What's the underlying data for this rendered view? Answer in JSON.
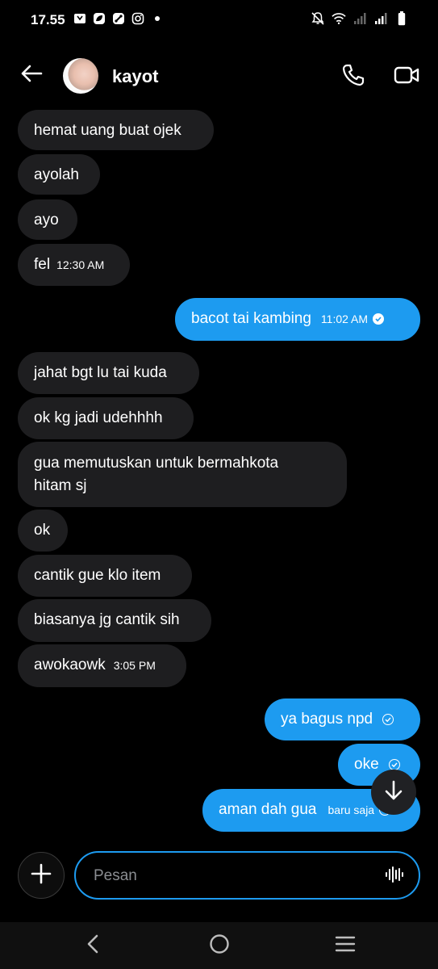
{
  "status": {
    "time": "17.55",
    "left_icons": [
      "clip-icon",
      "leaf-icon",
      "link-icon",
      "instagram-icon",
      "dot-icon"
    ],
    "right_icons": [
      "mute-icon",
      "wifi-icon",
      "signal-icon",
      "signal-icon",
      "battery-icon"
    ]
  },
  "header": {
    "contact_name": "kayot",
    "icons": [
      "back-arrow-icon",
      "phone-icon",
      "video-camera-icon"
    ]
  },
  "messages": [
    {
      "dir": "in",
      "text": "hemat uang buat ojek",
      "time": ""
    },
    {
      "dir": "in",
      "text": "ayolah",
      "time": ""
    },
    {
      "dir": "in",
      "text": "ayo",
      "time": ""
    },
    {
      "dir": "in",
      "text": "fel",
      "time": "12:30 AM"
    },
    {
      "dir": "out",
      "text": "bacot tai kambing",
      "time": "11:02 AM",
      "status": "read"
    },
    {
      "dir": "in",
      "text": "jahat bgt lu tai kuda",
      "time": ""
    },
    {
      "dir": "in",
      "text": "ok kg jadi udehhhh",
      "time": ""
    },
    {
      "dir": "in",
      "text": "gua memutuskan untuk bermahkota hitam sj",
      "time": ""
    },
    {
      "dir": "in",
      "text": "ok",
      "time": ""
    },
    {
      "dir": "in",
      "text": "cantik gue klo item",
      "time": ""
    },
    {
      "dir": "in",
      "text": "biasanya jg cantik sih",
      "time": ""
    },
    {
      "dir": "in",
      "text": "awokaowk",
      "time": "3:05 PM"
    },
    {
      "dir": "out",
      "text": "ya bagus npd",
      "time": "",
      "status": "sent"
    },
    {
      "dir": "out",
      "text": "oke",
      "time": "",
      "status": "sent"
    },
    {
      "dir": "out",
      "text": "aman dah gua",
      "time": "baru saja",
      "status": "sent"
    }
  ],
  "composer": {
    "placeholder": "Pesan",
    "icons": [
      "plus-icon",
      "voice-wave-icon",
      "scroll-down-arrow-icon"
    ]
  },
  "colors": {
    "outgoing_bubble": "#1d9bf0",
    "incoming_bubble": "#1e1e20",
    "background": "#000000"
  }
}
